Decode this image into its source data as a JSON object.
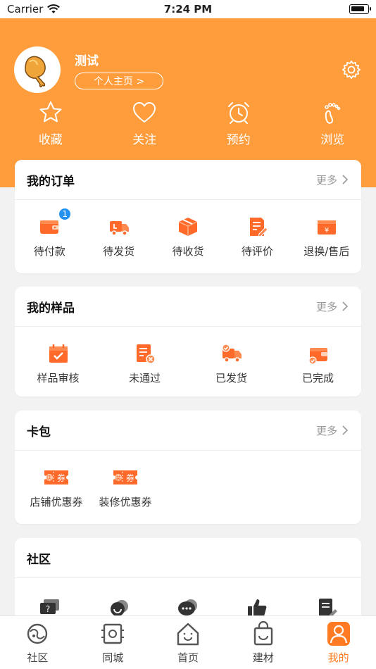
{
  "status_bar": {
    "carrier": "Carrier",
    "time": "7:24 PM"
  },
  "profile": {
    "name": "测试",
    "homepage_button": "个人主页 >"
  },
  "quick_actions": [
    {
      "label": "收藏",
      "icon": "star-icon"
    },
    {
      "label": "关注",
      "icon": "heart-icon"
    },
    {
      "label": "预约",
      "icon": "alarm-clock-icon"
    },
    {
      "label": "浏览",
      "icon": "footprint-icon"
    }
  ],
  "orders": {
    "title": "我的订单",
    "more": "更多",
    "items": [
      {
        "label": "待付款",
        "icon": "wallet-icon",
        "badge": "1"
      },
      {
        "label": "待发货",
        "icon": "delivery-truck-icon"
      },
      {
        "label": "待收货",
        "icon": "package-box-icon"
      },
      {
        "label": "待评价",
        "icon": "review-edit-icon"
      },
      {
        "label": "退换/售后",
        "icon": "refund-icon"
      }
    ]
  },
  "samples": {
    "title": "我的样品",
    "more": "更多",
    "items": [
      {
        "label": "样品审核",
        "icon": "calendar-check-icon"
      },
      {
        "label": "未通过",
        "icon": "document-reject-icon"
      },
      {
        "label": "已发货",
        "icon": "shipped-truck-icon"
      },
      {
        "label": "已完成",
        "icon": "wallet-check-icon"
      }
    ]
  },
  "card_wallet": {
    "title": "卡包",
    "more": "更多",
    "items": [
      {
        "label": "店铺优惠券",
        "icon": "store-coupon-icon",
        "tag": "店",
        "ticket": "券"
      },
      {
        "label": "装修优惠券",
        "icon": "decoration-coupon-icon",
        "tag": "装",
        "ticket": "券"
      }
    ]
  },
  "community": {
    "title": "社区"
  },
  "tabbar": {
    "items": [
      {
        "label": "社区",
        "icon": "planet-icon"
      },
      {
        "label": "同城",
        "icon": "local-icon"
      },
      {
        "label": "首页",
        "icon": "home-icon"
      },
      {
        "label": "建材",
        "icon": "shopping-bag-icon"
      },
      {
        "label": "我的",
        "icon": "profile-icon",
        "active": true
      }
    ]
  },
  "colors": {
    "accent": "#ff9c3c",
    "icon_orange": "#ff6a2a",
    "active_tab": "#ff7a20",
    "badge": "#2490f0"
  }
}
